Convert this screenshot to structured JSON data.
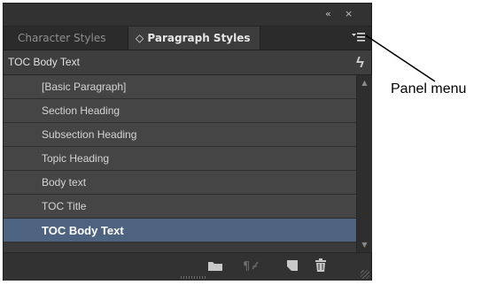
{
  "panel": {
    "controls": {
      "collapse": "«",
      "close": "×"
    },
    "tabs": [
      {
        "label": "Character Styles",
        "active": false
      },
      {
        "label": "Paragraph Styles",
        "active": true,
        "glyph": "◇"
      }
    ],
    "menu_icon": "panel-menu-icon",
    "current_style": {
      "label": "TOC Body Text",
      "override_icon": "lightning-bolt-icon",
      "override_glyph": "ϟ"
    },
    "styles": [
      {
        "label": "[Basic Paragraph]",
        "selected": false
      },
      {
        "label": "Section Heading",
        "selected": false
      },
      {
        "label": "Subsection Heading",
        "selected": false
      },
      {
        "label": "Topic Heading",
        "selected": false
      },
      {
        "label": "Body text",
        "selected": false
      },
      {
        "label": "TOC Title",
        "selected": false
      },
      {
        "label": "TOC Body Text",
        "selected": true
      }
    ],
    "bottom_buttons": [
      {
        "name": "new-style-group-button",
        "icon": "folder-icon"
      },
      {
        "name": "clear-overrides-button",
        "icon": "clear-overrides-icon",
        "disabled": true
      },
      {
        "name": "create-new-style-button",
        "icon": "new-page-icon"
      },
      {
        "name": "delete-style-button",
        "icon": "trash-icon"
      }
    ]
  },
  "annotation": {
    "text": "Panel menu"
  },
  "colors": {
    "panel_bg": "#3a3a3a",
    "row_bg": "#454545",
    "selected_row": "#4d637f"
  }
}
